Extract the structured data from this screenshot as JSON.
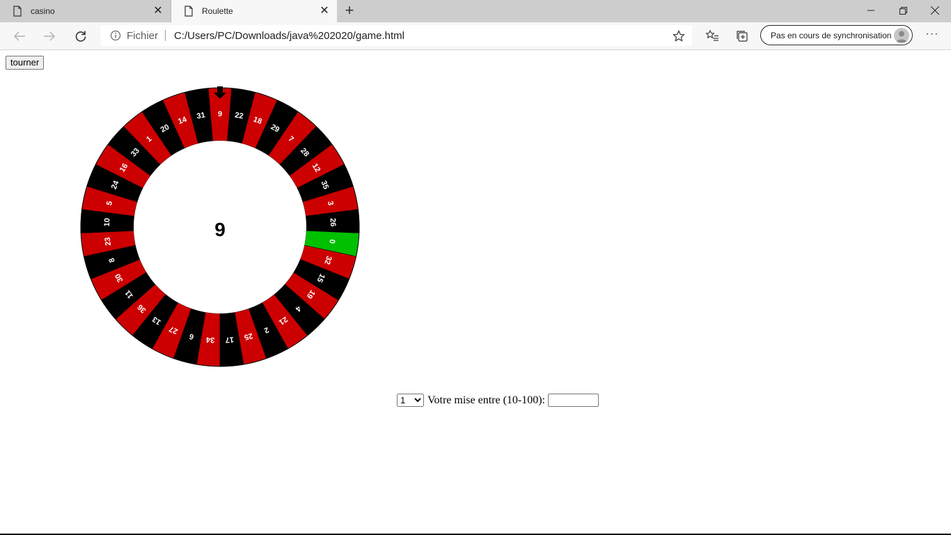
{
  "browser": {
    "tabs": [
      {
        "title": "casino",
        "active": false
      },
      {
        "title": "Roulette",
        "active": true
      }
    ],
    "address": {
      "scheme_label": "Fichier",
      "url": "C:/Users/PC/Downloads/java%202020/game.html"
    },
    "sync_label": "Pas en cours de synchronisation"
  },
  "page": {
    "spin_button": "tourner",
    "bet_label": "Votre mise entre (10-100):",
    "bet_select_value": "1",
    "bet_select_options": [
      "1"
    ],
    "bet_input_value": ""
  },
  "roulette": {
    "result": "9",
    "pointer_number": "9",
    "numbers": [
      9,
      22,
      18,
      29,
      7,
      28,
      12,
      35,
      3,
      26,
      0,
      32,
      15,
      19,
      4,
      21,
      2,
      25,
      17,
      34,
      6,
      27,
      13,
      36,
      11,
      30,
      8,
      23,
      10,
      5,
      24,
      16,
      33,
      1,
      20,
      14,
      31
    ],
    "colors": {
      "red": "#cc0000",
      "black": "#000000",
      "green": "#00c000",
      "label": "#ffffff",
      "pointer": "#000000"
    },
    "red_numbers": [
      1,
      3,
      5,
      7,
      9,
      12,
      14,
      16,
      18,
      19,
      21,
      23,
      25,
      27,
      30,
      32,
      34,
      36
    ]
  }
}
